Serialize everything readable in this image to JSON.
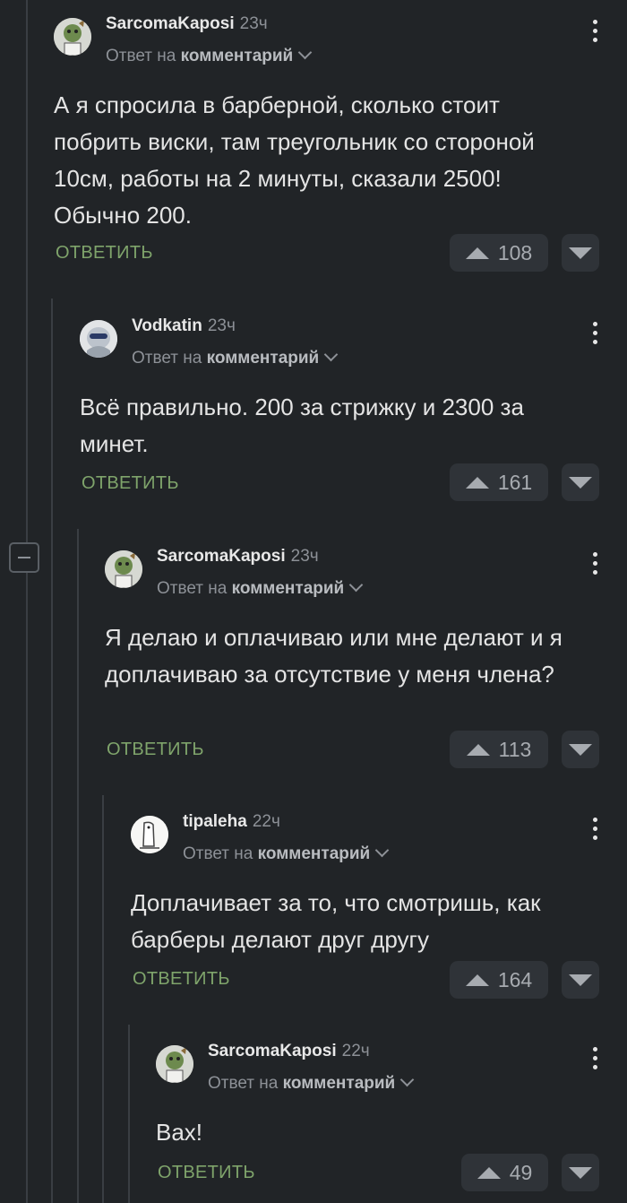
{
  "comments": [
    {
      "author": "SarcomaKaposi",
      "time": "23ч",
      "reply_prefix": "Ответ на",
      "reply_target": "комментарий",
      "text": "А я спросила в барберной, сколько стоит побрить виски, там треугольник со стороной 10см, работы на 2 минуты, сказали 2500! Обычно 200.",
      "reply_label": "ОТВЕТИТЬ",
      "rating": "108"
    },
    {
      "author": "Vodkatin",
      "time": "23ч",
      "reply_prefix": "Ответ на",
      "reply_target": "комментарий",
      "text": "Всё правильно. 200 за стрижку и 2300 за минет.",
      "reply_label": "ОТВЕТИТЬ",
      "rating": "161"
    },
    {
      "author": "SarcomaKaposi",
      "time": "23ч",
      "reply_prefix": "Ответ на",
      "reply_target": "комментарий",
      "text": "Я делаю и оплачиваю или мне делают и я доплачиваю за отсутствие у меня члена?",
      "reply_label": "ОТВЕТИТЬ",
      "rating": "113"
    },
    {
      "author": "tipaleha",
      "time": "22ч",
      "reply_prefix": "Ответ на",
      "reply_target": "комментарий",
      "text": "Доплачивает за то, что смотришь, как барберы делают друг другу",
      "reply_label": "ОТВЕТИТЬ",
      "rating": "164"
    },
    {
      "author": "SarcomaKaposi",
      "time": "22ч",
      "reply_prefix": "Ответ на",
      "reply_target": "комментарий",
      "text": "Вах!",
      "reply_label": "ОТВЕТИТЬ",
      "rating": "49"
    }
  ],
  "icons": {
    "collapse": "minus-square-icon",
    "more": "kebab-icon",
    "upvote": "triangle-up-icon",
    "downvote": "triangle-down-icon",
    "dropdown": "chevron-down-icon"
  },
  "colors": {
    "background": "#212427",
    "accent_reply": "#7fa46b",
    "vote_bg": "#2f3338"
  }
}
